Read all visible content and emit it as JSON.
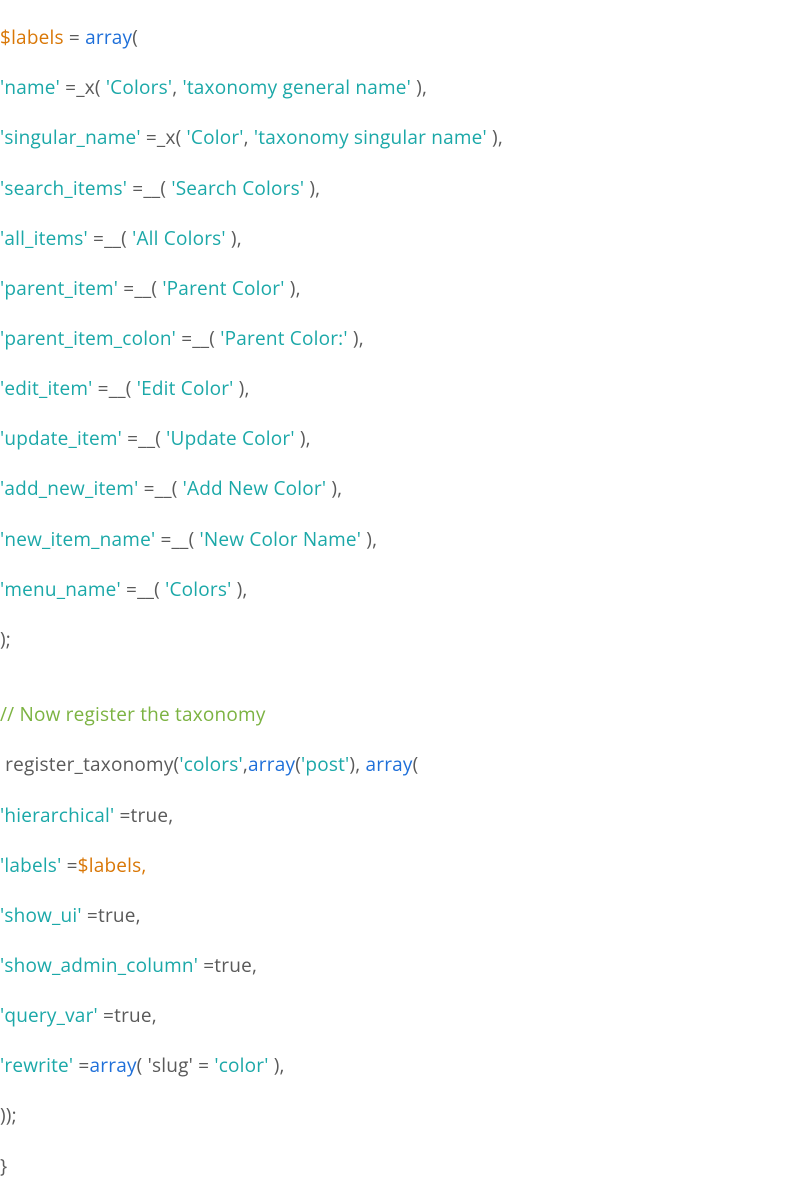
{
  "code": {
    "l1": {
      "var": "$labels",
      "eq": " = ",
      "arr": "array",
      "open": "("
    },
    "l2": {
      "key": "'name'",
      "op": " =_x( ",
      "v1": "'Colors'",
      "comma": ", ",
      "v2": "'taxonomy general name'",
      "close": " ),"
    },
    "l3": {
      "key": "'singular_name'",
      "op": " =_x( ",
      "v1": "'Color'",
      "comma": ", ",
      "v2": "'taxonomy singular name'",
      "close": " ),"
    },
    "l4": {
      "key": "'search_items'",
      "op": " =__( ",
      "v1": "'Search Colors'",
      "close": " ),"
    },
    "l5": {
      "key": "'all_items'",
      "op": " =__( ",
      "v1": "'All Colors'",
      "close": " ),"
    },
    "l6": {
      "key": "'parent_item'",
      "op": " =__( ",
      "v1": "'Parent Color'",
      "close": " ),"
    },
    "l7": {
      "key": "'parent_item_colon'",
      "op": " =__( ",
      "v1": "'Parent Color:'",
      "close": " ),"
    },
    "l8": {
      "key": "'edit_item'",
      "op": " =__( ",
      "v1": "'Edit Color'",
      "close": " ),"
    },
    "l9": {
      "key": "'update_item'",
      "op": " =__( ",
      "v1": "'Update Color'",
      "close": " ),"
    },
    "l10": {
      "key": "'add_new_item'",
      "op": " =__( ",
      "v1": "'Add New Color'",
      "close": " ),"
    },
    "l11": {
      "key": "'new_item_name'",
      "op": " =__( ",
      "v1": "'New Color Name'",
      "close": " ),"
    },
    "l12": {
      "key": "'menu_name'",
      "op": " =__( ",
      "v1": "'Colors'",
      "close": " ),"
    },
    "l13": {
      "txt": ");"
    },
    "l14": {
      "txt": ""
    },
    "l15": {
      "txt": "// Now register the taxonomy"
    },
    "l16": {
      "pre": " register_taxonomy(",
      "v1": "'colors'",
      "comma1": ",",
      "arr1": "array",
      "open1": "(",
      "v2": "'post'",
      "close1": "), ",
      "arr2": "array",
      "open2": "("
    },
    "l17": {
      "key": "'hierarchical'",
      "op": " =",
      "val": "true,"
    },
    "l18": {
      "key": "'labels'",
      "op": " =",
      "var": "$labels,"
    },
    "l19": {
      "key": "'show_ui'",
      "op": " =",
      "val": "true,"
    },
    "l20": {
      "key": "'show_admin_column'",
      "op": " =",
      "val": "true,"
    },
    "l21": {
      "key": "'query_var'",
      "op": " =",
      "val": "true,"
    },
    "l22": {
      "key": "'rewrite'",
      "op": " =",
      "arr": "array",
      "open": "( ",
      "slug": "'slug'",
      "eq": " = ",
      "val": "'color'",
      "close": " ),"
    },
    "l23": {
      "txt": "));"
    },
    "l24": {
      "txt": "}"
    }
  }
}
